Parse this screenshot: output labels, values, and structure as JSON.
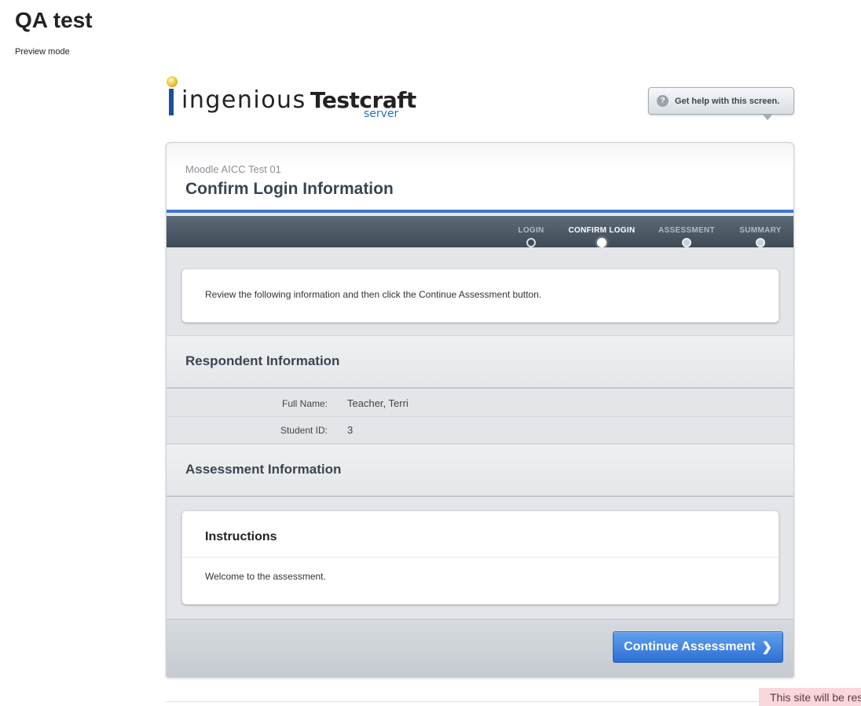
{
  "page": {
    "title": "QA test",
    "preview_label": "Preview mode"
  },
  "logo": {
    "word_ingenious": "ingenious",
    "word_testcraft": "Testcraft",
    "word_server": "server"
  },
  "help": {
    "icon": "question-icon",
    "icon_glyph": "?",
    "label": "Get help with this screen."
  },
  "header": {
    "subtitle": "Moodle AICC Test 01",
    "title": "Confirm Login Information"
  },
  "steps": [
    {
      "label": "LOGIN",
      "state": "done"
    },
    {
      "label": "CONFIRM LOGIN",
      "state": "active"
    },
    {
      "label": "ASSESSMENT",
      "state": "pending"
    },
    {
      "label": "SUMMARY",
      "state": "pending"
    }
  ],
  "notice": "Review the following information and then click the Continue Assessment button.",
  "respondent": {
    "heading": "Respondent Information",
    "rows": [
      {
        "label": "Full Name:",
        "value": "Teacher, Terri"
      },
      {
        "label": "Student ID:",
        "value": "3"
      }
    ]
  },
  "assessment": {
    "heading": "Assessment Information",
    "instructions_heading": "Instructions",
    "instructions_text": "Welcome to the assessment."
  },
  "actions": {
    "continue_label": "Continue Assessment",
    "continue_icon": "chevron-right-icon",
    "continue_glyph": "❯"
  },
  "site_notice": "This site will be res",
  "colors": {
    "accent": "#3c76cf",
    "stepbar": "#4a5663",
    "button": "#2d6fd3",
    "site_notice_bg": "#f9d7dc"
  }
}
